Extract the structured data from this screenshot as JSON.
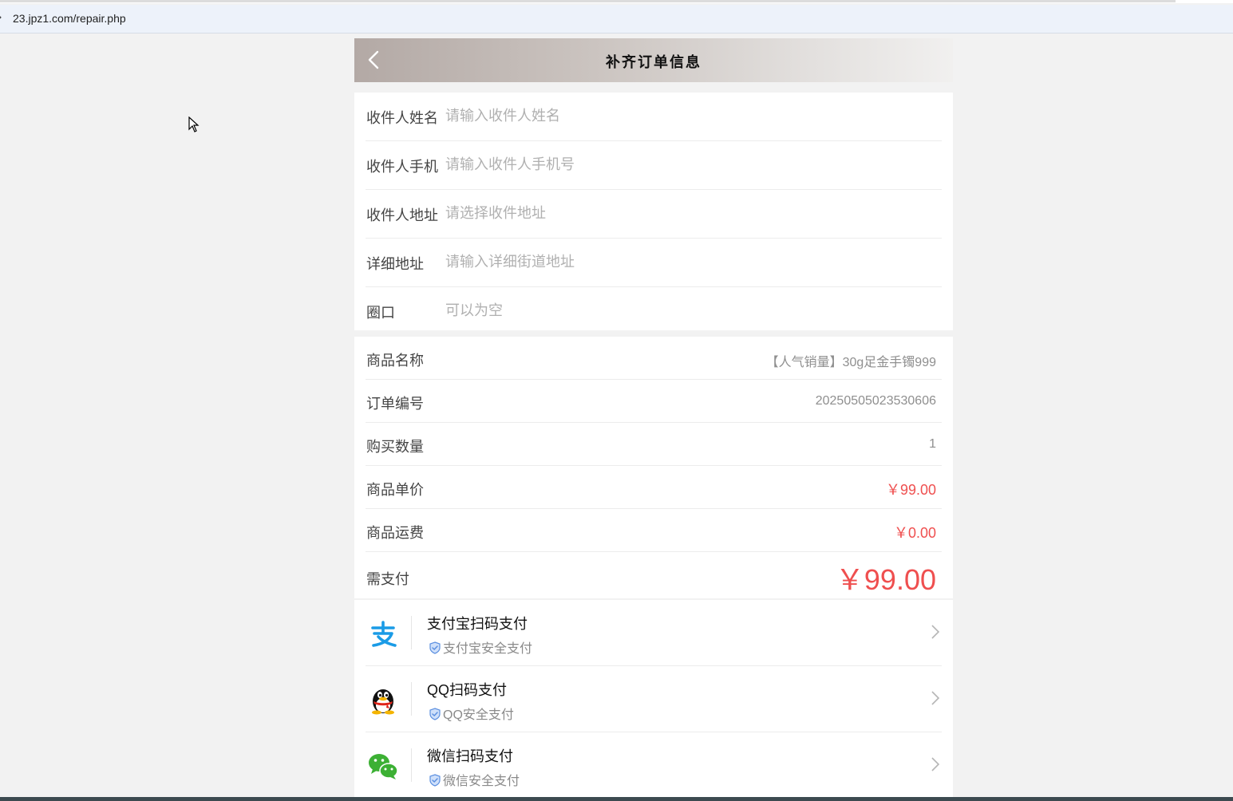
{
  "browser": {
    "url": "23.jpz1.com/repair.php"
  },
  "header": {
    "title": "补齐订单信息"
  },
  "form": {
    "name_label": "收件人姓名",
    "name_placeholder": "请输入收件人姓名",
    "phone_label": "收件人手机",
    "phone_placeholder": "请输入收件人手机号",
    "address_label": "收件人地址",
    "address_placeholder": "请选择收件地址",
    "detail_label": "详细地址",
    "detail_placeholder": "请输入详细街道地址",
    "ring_label": "圈口",
    "ring_placeholder": "可以为空"
  },
  "order": {
    "product_label": "商品名称",
    "product_value": "【人气销量】30g足金手镯999",
    "order_no_label": "订单编号",
    "order_no_value": "20250505023530606",
    "qty_label": "购买数量",
    "qty_value": "1",
    "unit_price_label": "商品单价",
    "unit_price_value": "￥99.00",
    "shipping_label": "商品运费",
    "shipping_value": "￥0.00",
    "total_label": "需支付",
    "total_value": "￥99.00"
  },
  "payment": {
    "alipay_title": "支付宝扫码支付",
    "alipay_sub": "支付宝安全支付",
    "qq_title": "QQ扫码支付",
    "qq_sub": "QQ安全支付",
    "wechat_title": "微信扫码支付",
    "wechat_sub": "微信安全支付"
  },
  "colors": {
    "accent_red": "#ef4f4f",
    "alipay_blue": "#1a9be6",
    "wechat_green": "#3cb034",
    "shield_blue": "#5b8fe0"
  }
}
